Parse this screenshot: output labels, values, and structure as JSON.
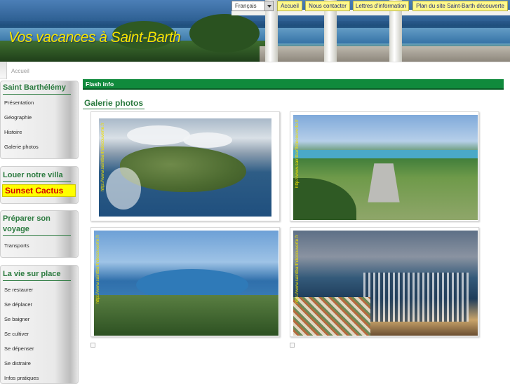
{
  "header": {
    "site_title": "Vos vacances à Saint-Barth",
    "language_selector": {
      "selected": "Français"
    },
    "nav": [
      {
        "label": "Accueil"
      },
      {
        "label": "Nous contacter"
      },
      {
        "label": "Lettres d'information"
      },
      {
        "label": "Plan du site Saint-Barth découverte"
      }
    ]
  },
  "breadcrumb": {
    "current": "Accueil"
  },
  "sidebar": {
    "sections": [
      {
        "heading": "Saint Barthélémy",
        "links": [
          "Présentation",
          "Géographie",
          "Histoire",
          "Galerie photos"
        ]
      },
      {
        "heading": "Louer notre villa",
        "highlight": "Sunset Cactus"
      },
      {
        "heading": "Préparer son voyage",
        "links": [
          "Transports"
        ]
      },
      {
        "heading": "La vie sur place",
        "links": [
          "Se restaurer",
          "Se déplacer",
          "Se baigner",
          "Se cultiver",
          "Se dépenser",
          "Se distraire",
          "Infos pratiques"
        ]
      }
    ]
  },
  "main": {
    "flash_info": "Flash info",
    "gallery_title": "Galerie photos",
    "photo_credit": "http://www.saintbarthdecouverte.fr"
  },
  "colors": {
    "accent_green": "#2b7a3f",
    "flash_bar": "#108a3c",
    "title_yellow": "#f5e400",
    "highlight_yellow": "#ffff00",
    "highlight_red": "#d40000"
  }
}
